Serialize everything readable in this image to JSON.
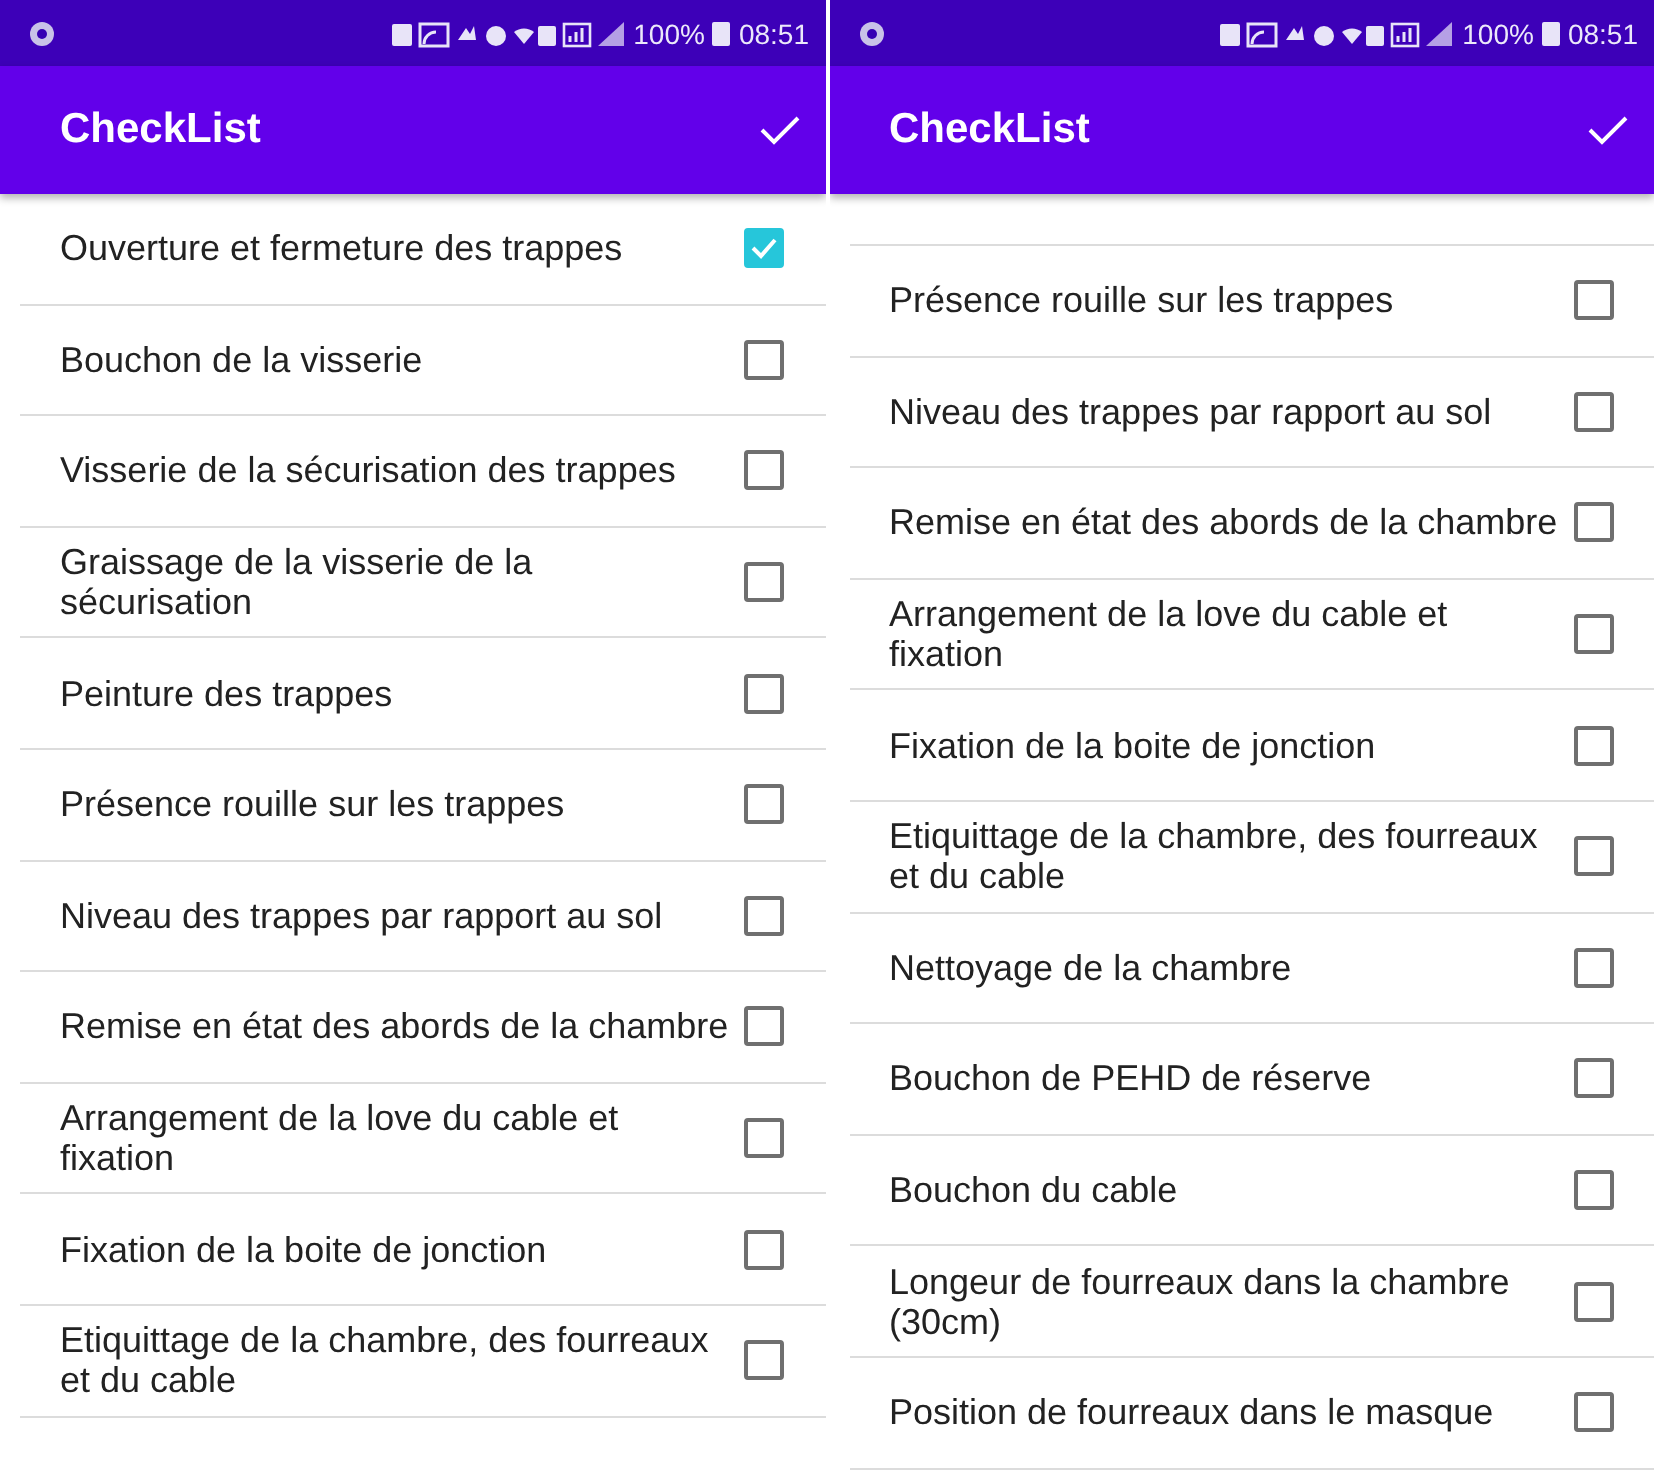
{
  "screens": [
    {
      "status_bar": {
        "battery": "100%",
        "time": "08:51"
      },
      "toolbar": {
        "title": "CheckList"
      },
      "items": [
        {
          "label": "Ouverture et fermeture des trappes",
          "checked": true
        },
        {
          "label": "Bouchon de la visserie",
          "checked": false
        },
        {
          "label": "Visserie de la sécurisation des trappes",
          "checked": false
        },
        {
          "label": "Graissage de la visserie de la sécurisation",
          "checked": false
        },
        {
          "label": "Peinture des trappes",
          "checked": false
        },
        {
          "label": "Présence rouille sur les trappes",
          "checked": false
        },
        {
          "label": "Niveau des trappes par rapport au sol",
          "checked": false
        },
        {
          "label": "Remise en état des abords de la chambre",
          "checked": false
        },
        {
          "label": "Arrangement de la love du cable et fixation",
          "checked": false
        },
        {
          "label": "Fixation de la boite de jonction",
          "checked": false
        },
        {
          "label": "Etiquittage de la chambre, des fourreaux et du cable",
          "checked": false
        }
      ]
    },
    {
      "status_bar": {
        "battery": "100%",
        "time": "08:51"
      },
      "toolbar": {
        "title": "CheckList"
      },
      "items": [
        {
          "label": "Présence rouille sur les trappes",
          "checked": false
        },
        {
          "label": "Niveau des trappes par rapport au sol",
          "checked": false
        },
        {
          "label": "Remise en état des abords de la chambre",
          "checked": false
        },
        {
          "label": "Arrangement de la love du cable et fixation",
          "checked": false
        },
        {
          "label": "Fixation de la boite de jonction",
          "checked": false
        },
        {
          "label": "Etiquittage de la chambre, des fourreaux et du cable",
          "checked": false
        },
        {
          "label": "Nettoyage de la chambre",
          "checked": false
        },
        {
          "label": "Bouchon de PEHD de réserve",
          "checked": false
        },
        {
          "label": "Bouchon du cable",
          "checked": false
        },
        {
          "label": "Longeur de fourreaux dans la chambre (30cm)",
          "checked": false
        },
        {
          "label": "Position de fourreaux dans le masque",
          "checked": false
        }
      ]
    }
  ]
}
